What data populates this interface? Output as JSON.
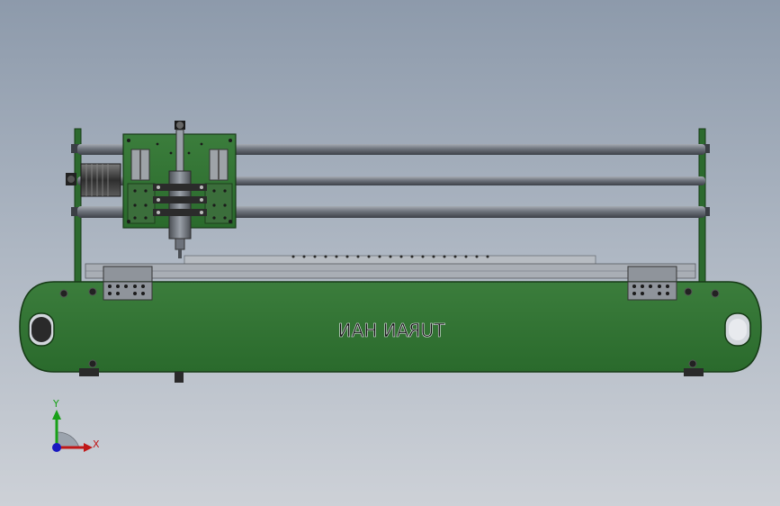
{
  "model": {
    "engraving_text": "TURAN HAN"
  },
  "triad": {
    "y_label": "Y",
    "x_label": "X"
  },
  "colors": {
    "frame_green": "#2e6f30",
    "frame_dark": "#1c3f1c",
    "rod": "#7a7f89",
    "axis_x": "#c01818",
    "axis_y": "#18a018",
    "axis_z": "#1818c0"
  }
}
